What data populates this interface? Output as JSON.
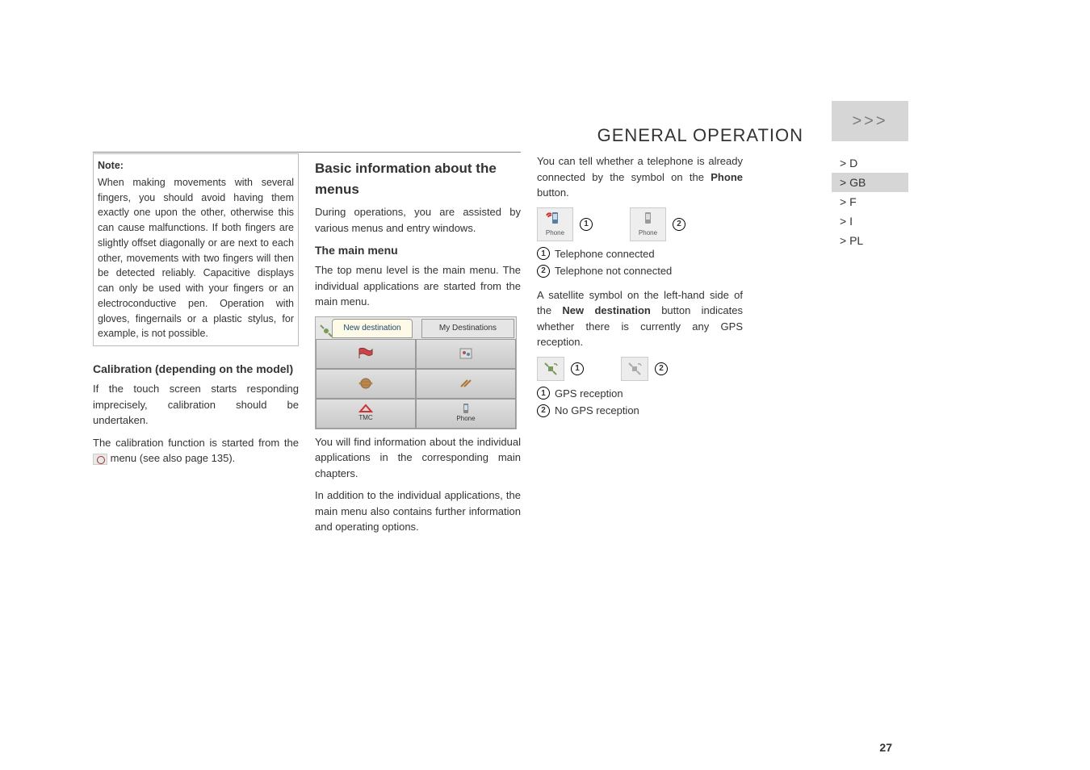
{
  "header": {
    "title": "GENERAL OPERATION",
    "arrows": ">>>"
  },
  "nav": {
    "items": [
      "> D",
      "> GB",
      "> F",
      "> I",
      "> PL"
    ],
    "active_index": 1
  },
  "col1": {
    "note_label": "Note:",
    "note_text": "When making movements with several fingers, you should avoid having them exactly one upon the other, otherwise this can cause malfunctions. If both fingers are slightly offset diagonally or are next to each other, movements with two fingers will then be detected reliably. Capacitive displays can only be used with your fingers or an electroconductive pen. Operation with gloves, fingernails or a plastic stylus, for example, is not possible.",
    "calibration_heading": "Calibration (depending on the model)",
    "calibration_p1": "If the touch screen starts responding imprecisely, calibration should be undertaken.",
    "calibration_p2a": "The calibration function is started from the ",
    "calibration_p2b": " menu (see also page 135)."
  },
  "col2": {
    "heading": "Basic information about the menus",
    "intro": "During operations, you are assisted by various menus and entry windows.",
    "main_menu_heading": "The main menu",
    "main_menu_p1": "The top menu level is the main menu. The individual applications are started from the main menu.",
    "menu_img": {
      "tab_left": "New destination",
      "tab_right": "My Destinations",
      "bottom_left": "TMC",
      "bottom_right": "Phone"
    },
    "main_menu_p2": "You will find information about the individual applications in the corresponding main chapters.",
    "main_menu_p3": "In addition to the individual applications, the main menu also contains further information and operating options."
  },
  "col3": {
    "phone_intro_a": "You can tell whether a telephone is already connected by the symbol on the ",
    "phone_intro_b": "Phone",
    "phone_intro_c": " button.",
    "phone_label": "Phone",
    "legend_phone_1": "Telephone connected",
    "legend_phone_2": "Telephone not connected",
    "sat_intro_a": "A satellite symbol on the left-hand side of the ",
    "sat_intro_b": "New destination",
    "sat_intro_c": " button indicates whether there is currently any GPS reception.",
    "legend_gps_1": "GPS reception",
    "legend_gps_2": "No GPS reception",
    "num1": "1",
    "num2": "2"
  },
  "page_number": "27"
}
